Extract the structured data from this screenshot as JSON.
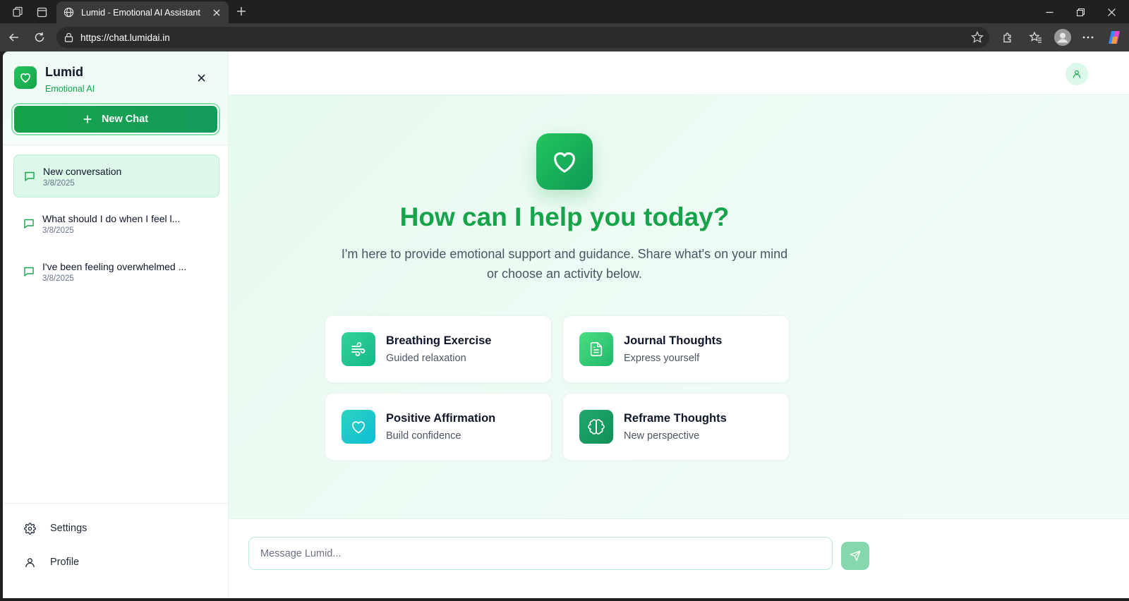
{
  "browser": {
    "tab_title": "Lumid - Emotional AI Assistant",
    "url": "https://chat.lumidai.in"
  },
  "sidebar": {
    "brand": "Lumid",
    "brand_sub": "Emotional AI",
    "new_chat_label": "New Chat",
    "conversations": [
      {
        "title": "New conversation",
        "date": "3/8/2025"
      },
      {
        "title": "What should I do when I feel l...",
        "date": "3/8/2025"
      },
      {
        "title": "I've been feeling overwhelmed ...",
        "date": "3/8/2025"
      }
    ],
    "footer": {
      "settings_label": "Settings",
      "profile_label": "Profile"
    }
  },
  "main": {
    "title": "How can I help you today?",
    "subtitle": "I'm here to provide emotional support and guidance. Share what's on your mind or choose an activity below.",
    "cards": [
      {
        "title": "Breathing Exercise",
        "subtitle": "Guided relaxation",
        "icon": "wind-icon",
        "color": "#2bc48f"
      },
      {
        "title": "Journal Thoughts",
        "subtitle": "Express yourself",
        "icon": "file-text-icon",
        "color": "#34c97a"
      },
      {
        "title": "Positive Affirmation",
        "subtitle": "Build confidence",
        "icon": "heart-icon",
        "color": "#1ec4cf"
      },
      {
        "title": "Reframe Thoughts",
        "subtitle": "New perspective",
        "icon": "brain-icon",
        "color": "#169d63"
      }
    ]
  },
  "composer": {
    "placeholder": "Message Lumid..."
  },
  "colors": {
    "brand_green": "#16a34a",
    "light_green_bg": "#e6faef",
    "send_button": "#86d7ab"
  }
}
